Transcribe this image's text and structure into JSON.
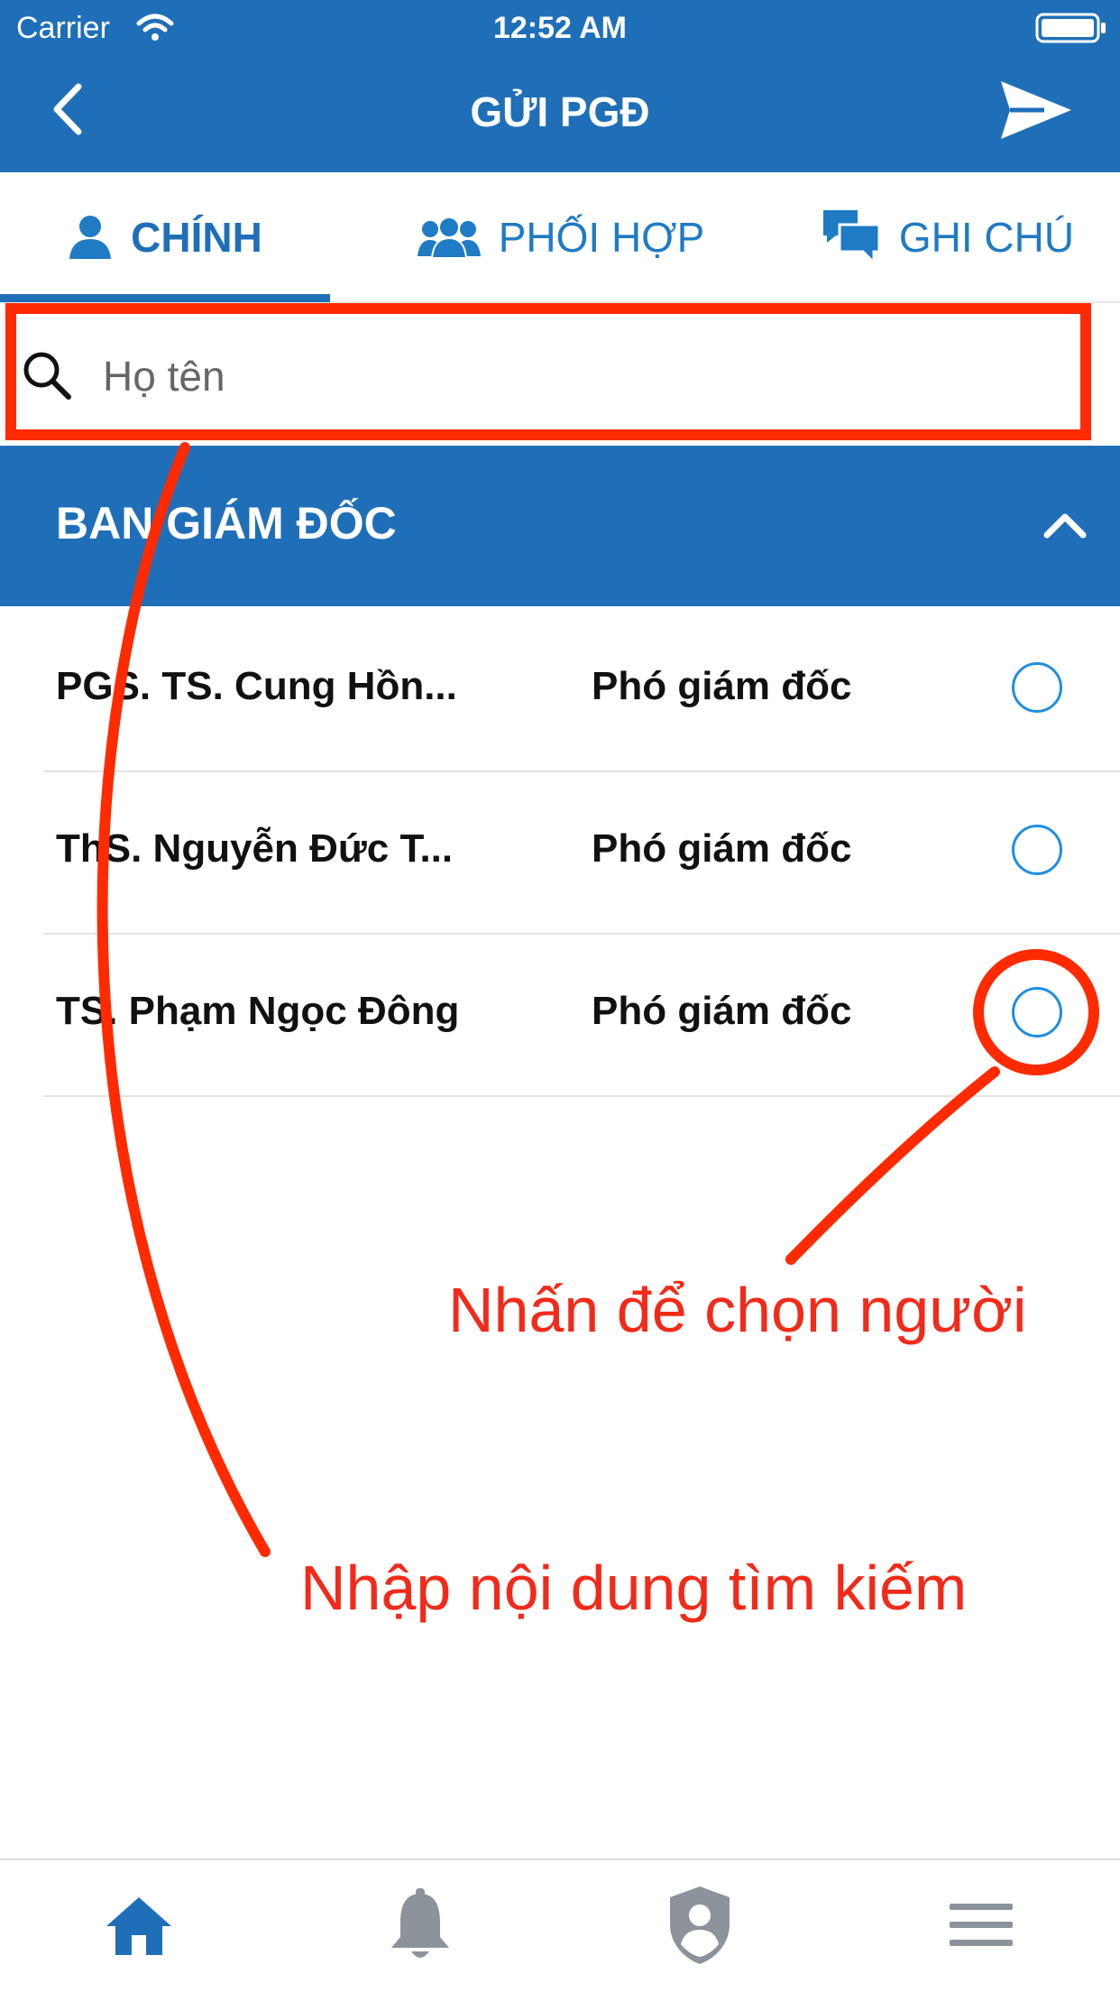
{
  "status_bar": {
    "carrier": "Carrier",
    "time": "12:52 AM",
    "wifi_icon": "wifi-icon",
    "battery_icon": "battery-icon"
  },
  "nav": {
    "title": "GỬI PGĐ",
    "back_icon": "chevron-left-icon",
    "send_icon": "send-icon",
    "color": "#1f6fb8"
  },
  "tabs": [
    {
      "label": "CHÍNH",
      "icon": "user-icon",
      "active": true
    },
    {
      "label": "PHỐI HỢP",
      "icon": "users-icon",
      "active": false
    },
    {
      "label": "GHI CHÚ",
      "icon": "chat-icon",
      "active": false
    }
  ],
  "search": {
    "placeholder": "Họ tên",
    "value": ""
  },
  "section": {
    "title": "BAN GIÁM ĐỐC",
    "collapse_icon": "chevron-up-icon"
  },
  "people": [
    {
      "name": "PGS. TS. Cung Hồn...",
      "role": "Phó giám đốc",
      "selected": false
    },
    {
      "name": "ThS. Nguyễn Đức T...",
      "role": "Phó giám đốc",
      "selected": false
    },
    {
      "name": "TS. Phạm Ngọc Đông",
      "role": "Phó giám đốc",
      "selected": false
    }
  ],
  "annotations": {
    "select_hint": "Nhấn để chọn người",
    "search_hint": "Nhập nội dung tìm kiếm",
    "color": "#f22a1a"
  },
  "tabbar": [
    {
      "icon": "home-icon",
      "active": true
    },
    {
      "icon": "bell-icon",
      "active": false
    },
    {
      "icon": "shield-user-icon",
      "active": false
    },
    {
      "icon": "menu-icon",
      "active": false
    }
  ],
  "colors": {
    "primary": "#1f6fb8",
    "radio": "#1e8fe0",
    "annotation": "#ff2a00"
  }
}
